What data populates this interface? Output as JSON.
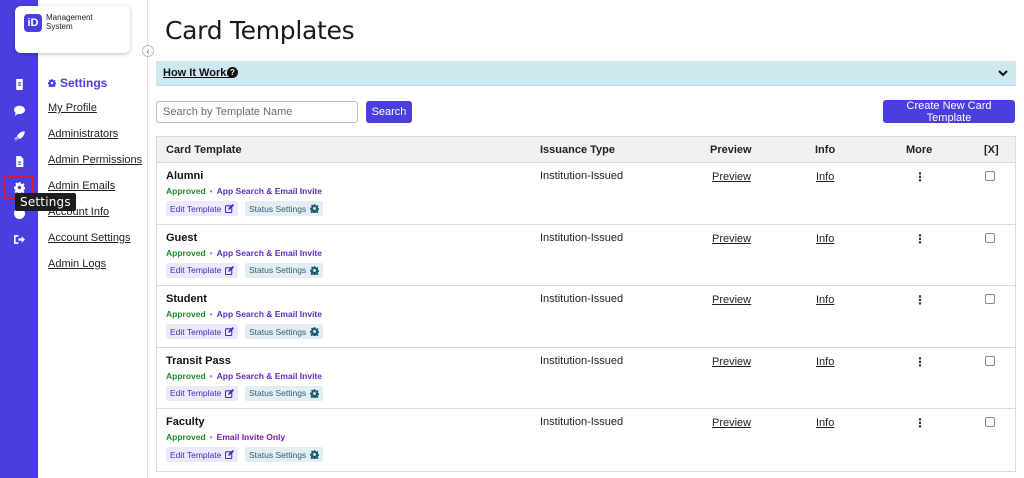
{
  "app": {
    "logo_badge": "iD",
    "logo_line1": "Management",
    "logo_line2": "System",
    "collapse_glyph": "‹"
  },
  "rail": {
    "icons": [
      "document-icon",
      "chat-icon",
      "rocket-icon",
      "file-icon",
      "gear-icon",
      "help-icon",
      "logout-icon"
    ],
    "tooltip": "Settings"
  },
  "settings_nav": {
    "title": "Settings",
    "items": [
      "My Profile",
      "Administrators",
      "Admin Permissions",
      "Admin Emails",
      "Account Info",
      "Account Settings",
      "Admin Logs"
    ]
  },
  "page": {
    "title": "Card Templates",
    "how_it_works": "How It Works",
    "help_glyph": "?"
  },
  "toolbar": {
    "search_placeholder": "Search by Template Name",
    "search_label": "Search",
    "create_label": "Create New Card Template"
  },
  "table": {
    "headers": [
      "Card Template",
      "Issuance Type",
      "Preview",
      "Info",
      "More",
      "[X]"
    ],
    "rows": [
      {
        "name": "Alumni",
        "status": "Approved",
        "method": "App Search & Email Invite",
        "edit": "Edit Template",
        "status_settings": "Status Settings",
        "issuance": "Institution-Issued",
        "preview": "Preview",
        "info": "Info"
      },
      {
        "name": "Guest",
        "status": "Approved",
        "method": "App Search & Email Invite",
        "edit": "Edit Template",
        "status_settings": "Status Settings",
        "issuance": "Institution-Issued",
        "preview": "Preview",
        "info": "Info"
      },
      {
        "name": "Student",
        "status": "Approved",
        "method": "App Search & Email Invite",
        "edit": "Edit Template",
        "status_settings": "Status Settings",
        "issuance": "Institution-Issued",
        "preview": "Preview",
        "info": "Info"
      },
      {
        "name": "Transit Pass",
        "status": "Approved",
        "method": "App Search & Email Invite",
        "edit": "Edit Template",
        "status_settings": "Status Settings",
        "issuance": "Institution-Issued",
        "preview": "Preview",
        "info": "Info"
      },
      {
        "name": "Faculty",
        "status": "Approved",
        "method": "Email Invite Only",
        "edit": "Edit Template",
        "status_settings": "Status Settings",
        "issuance": "Institution-Issued",
        "preview": "Preview",
        "info": "Info"
      }
    ]
  },
  "colors": {
    "brand": "#4a3ee0",
    "approved": "#1e8a2e",
    "method": "#5b2dbd",
    "banner": "#cde9ef"
  }
}
